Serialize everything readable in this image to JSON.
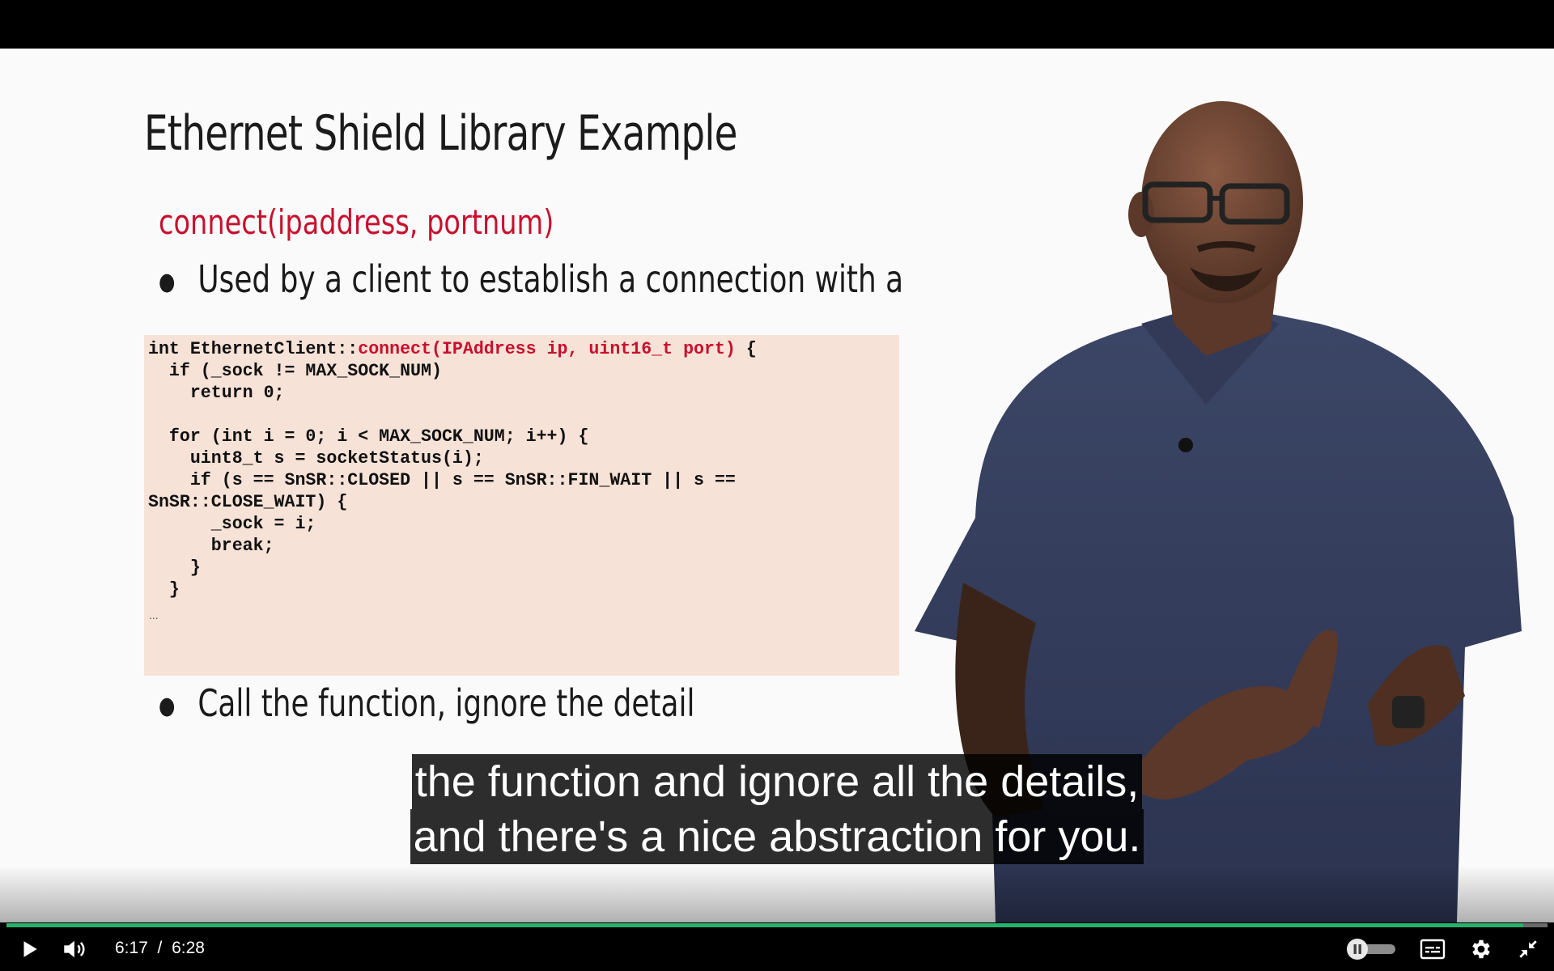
{
  "slide": {
    "title": "Ethernet Shield Library Example",
    "subtitle": "connect(ipaddress, portnum)",
    "bullets": [
      "Used by a client to establish a connection with a",
      "Call the function, ignore the detail"
    ],
    "code": {
      "line1_prefix": "int EthernetClient::",
      "line1_highlight": "connect(IPAddress ip, uint16_t port)",
      "line1_suffix": " {",
      "body": "  if (_sock != MAX_SOCK_NUM)\n    return 0;\n\n  for (int i = 0; i < MAX_SOCK_NUM; i++) {\n    uint8_t s = socketStatus(i);\n    if (s == SnSR::CLOSED || s == SnSR::FIN_WAIT || s ==\nSnSR::CLOSE_WAIT) {\n      _sock = i;\n      break;\n    }\n  }",
      "ellipsis": "..."
    }
  },
  "captions": {
    "line1": "the function and ignore all the details,",
    "line2": "and there's a nice abstraction for you."
  },
  "player": {
    "current_time": "6:17",
    "separator": "/",
    "duration": "6:28",
    "progress_fraction": 0.984,
    "accent_color": "#25b36c",
    "icons": {
      "play": "play-icon",
      "volume": "volume-icon",
      "autoplay": "autoplay-toggle-icon",
      "captions": "captions-icon",
      "settings": "gear-icon",
      "exit_fullscreen": "exit-fullscreen-icon"
    }
  }
}
